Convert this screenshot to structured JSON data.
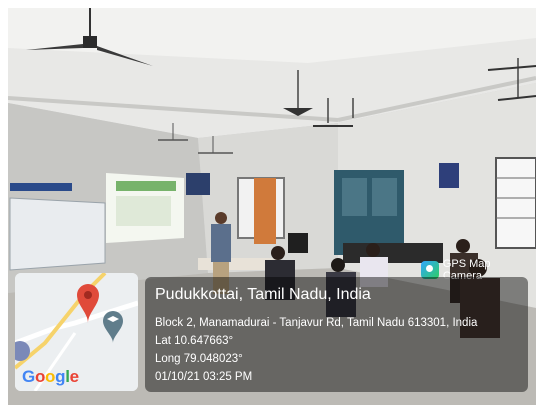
{
  "app_badge": {
    "label": "GPS Map Camera",
    "icon": "gps-camera-icon"
  },
  "location": {
    "title": "Pudukkottai, Tamil Nadu, India",
    "address": "Block 2, Manamadurai - Tanjavur Rd, Tamil Nadu 613301, India",
    "lat": "Lat 10.647663°",
    "long": "Long 79.048023°",
    "datetime": "01/10/21 03:25 PM"
  },
  "map": {
    "logo": [
      "G",
      "o",
      "o",
      "g",
      "l",
      "e"
    ],
    "logo_colors": [
      "#4285f4",
      "#ea4335",
      "#fbbc05",
      "#4285f4",
      "#34a853",
      "#ea4335"
    ],
    "marker_icon": "map-pin-icon",
    "poi_icon": "graduation-cap-icon"
  }
}
